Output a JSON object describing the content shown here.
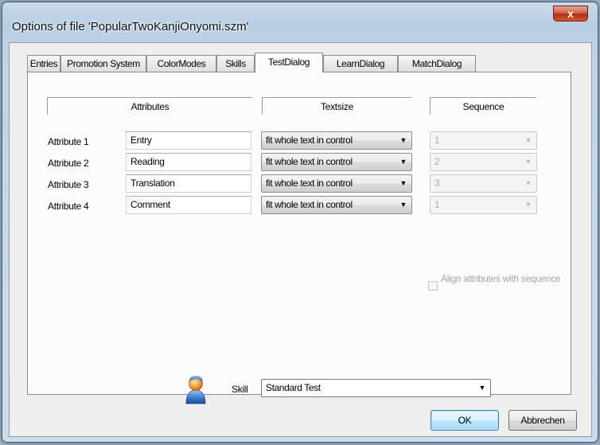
{
  "window": {
    "title": "Options of file 'PopularTwoKanjiOnyomi.szm'",
    "close_label": "x"
  },
  "tabs": [
    {
      "label": "Entries"
    },
    {
      "label": "Promotion System"
    },
    {
      "label": "ColorModes"
    },
    {
      "label": "Skills"
    },
    {
      "label": "TestDialog"
    },
    {
      "label": "LearnDialog"
    },
    {
      "label": "MatchDialog"
    }
  ],
  "active_tab": "TestDialog",
  "columns": {
    "attributes": "Attributes",
    "textsize": "Textsize",
    "sequence": "Sequence"
  },
  "rows": [
    {
      "label": "Attribute 1",
      "value": "Entry",
      "textsize": "fit whole text in control",
      "sequence": "1"
    },
    {
      "label": "Attribute 2",
      "value": "Reading",
      "textsize": "fit whole text in control",
      "sequence": "2"
    },
    {
      "label": "Attribute 3",
      "value": "Translation",
      "textsize": "fit whole text in control",
      "sequence": "3"
    },
    {
      "label": "Attribute 4",
      "value": "Comment",
      "textsize": "fit whole text in control",
      "sequence": "1"
    }
  ],
  "align_checkbox": {
    "label": "Align attributes with sequence",
    "checked": false,
    "enabled": false
  },
  "skill": {
    "label": "Skill",
    "value": "Standard Test",
    "icon": "user-icon"
  },
  "buttons": {
    "ok": "OK",
    "cancel": "Abbrechen"
  },
  "colors": {
    "window_frame": "#b7cde2",
    "close_button": "#c8432a",
    "default_button": "#bee6fd"
  }
}
